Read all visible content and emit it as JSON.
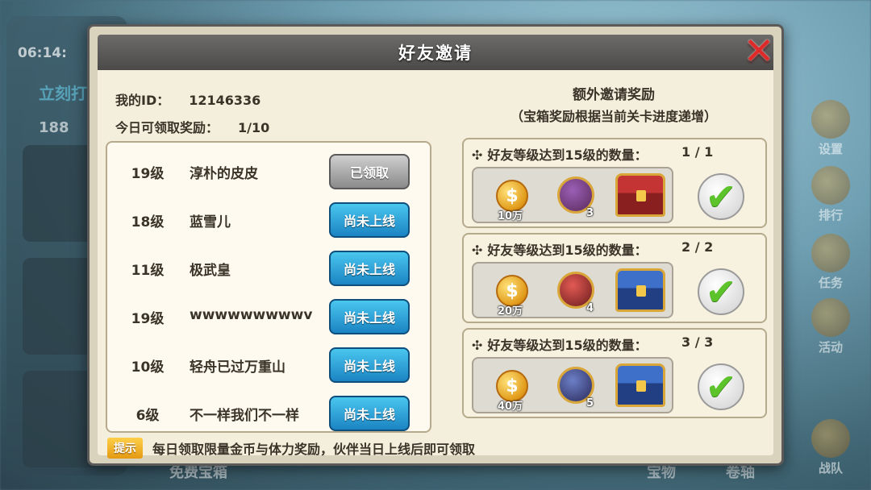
{
  "background": {
    "timer": "06:14:",
    "chest_label": "立刻打开",
    "gem_count": "188",
    "side_buttons": [
      "设置",
      "排行",
      "任务",
      "活动",
      "战队"
    ],
    "bottom_labels": [
      "免费宝箱",
      "宝物",
      "卷轴"
    ]
  },
  "modal": {
    "title": "好友邀请",
    "my_id_label": "我的ID：",
    "my_id_value": "12146336",
    "daily_label": "今日可领取奖励：",
    "daily_value": "1/10",
    "friends": [
      {
        "level": "19级",
        "name": "淳朴的皮皮",
        "status": "已领取",
        "state": "claimed"
      },
      {
        "level": "18级",
        "name": "蓝雪儿",
        "status": "尚未上线",
        "state": "offline"
      },
      {
        "level": "11级",
        "name": "极武皇",
        "status": "尚未上线",
        "state": "offline"
      },
      {
        "level": "19级",
        "name": "wwwwwwwwwv",
        "status": "尚未上线",
        "state": "offline"
      },
      {
        "level": "10级",
        "name": "轻舟已过万重山",
        "status": "尚未上线",
        "state": "offline"
      },
      {
        "level": "6级",
        "name": "不一样我们不一样",
        "status": "尚未上线",
        "state": "offline"
      }
    ],
    "extra_title": "额外邀请奖励",
    "extra_subtitle": "（宝箱奖励根据当前关卡进度递增）",
    "rewards": [
      {
        "requirement": "好友等级达到15级的数量：",
        "progress": "1 / 1",
        "coin": "10万",
        "hero_count": "3",
        "chest": "red",
        "done": true
      },
      {
        "requirement": "好友等级达到15级的数量：",
        "progress": "2 / 2",
        "coin": "20万",
        "hero_count": "4",
        "chest": "blue",
        "done": true
      },
      {
        "requirement": "好友等级达到15级的数量：",
        "progress": "3 / 3",
        "coin": "40万",
        "hero_count": "5",
        "chest": "blue",
        "done": true
      }
    ],
    "tip_label": "提示",
    "tip_text": "每日领取限量金币与体力奖励，伙伴当日上线后即可领取"
  }
}
